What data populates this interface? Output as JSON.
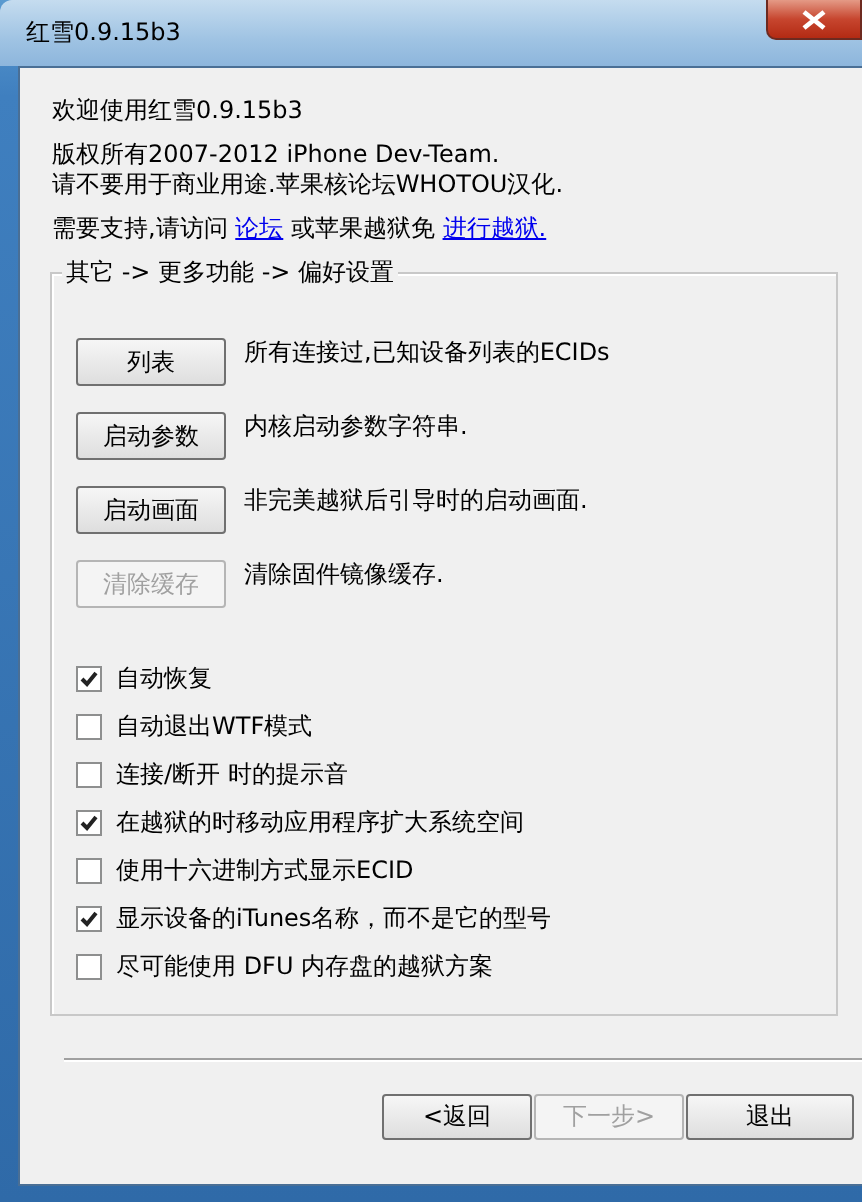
{
  "window": {
    "title": "红雪0.9.15b3"
  },
  "intro": {
    "welcome": "欢迎使用红雪0.9.15b3",
    "copyright": [
      "版权所有2007-2012 iPhone Dev-Team.",
      "请不要用于商业用途.苹果核论坛WHOTOU汉化."
    ],
    "support": [
      {
        "kind": "text",
        "text": "需要支持,请访问 "
      },
      {
        "kind": "link",
        "text": "论坛"
      },
      {
        "kind": "text",
        "text": " 或苹果越狱免 "
      },
      {
        "kind": "link",
        "text": "进行越狱."
      }
    ]
  },
  "group": {
    "title": "其它 -> 更多功能 -> 偏好设置",
    "actions": [
      {
        "label": "列表",
        "disabled": false,
        "description": "所有连接过,已知设备列表的ECIDs"
      },
      {
        "label": "启动参数",
        "disabled": false,
        "description": "内核启动参数字符串."
      },
      {
        "label": "启动画面",
        "disabled": false,
        "description": "非完美越狱后引导时的启动画面."
      },
      {
        "label": "清除缓存",
        "disabled": true,
        "description": "清除固件镜像缓存."
      }
    ],
    "options": [
      {
        "label": "自动恢复",
        "checked": true
      },
      {
        "label": "自动退出WTF模式",
        "checked": false
      },
      {
        "label": "连接/断开 时的提示音",
        "checked": false
      },
      {
        "label": "在越狱的时移动应用程序扩大系统空间",
        "checked": true
      },
      {
        "label": "使用十六进制方式显示ECID",
        "checked": false
      },
      {
        "label": "显示设备的iTunes名称，而不是它的型号",
        "checked": true
      },
      {
        "label": "尽可能使用 DFU 内存盘的越狱方案",
        "checked": false
      }
    ]
  },
  "buttons": [
    {
      "label": "<返回",
      "disabled": false
    },
    {
      "label": "下一步>",
      "disabled": true
    },
    {
      "label": "退出",
      "disabled": false
    }
  ]
}
